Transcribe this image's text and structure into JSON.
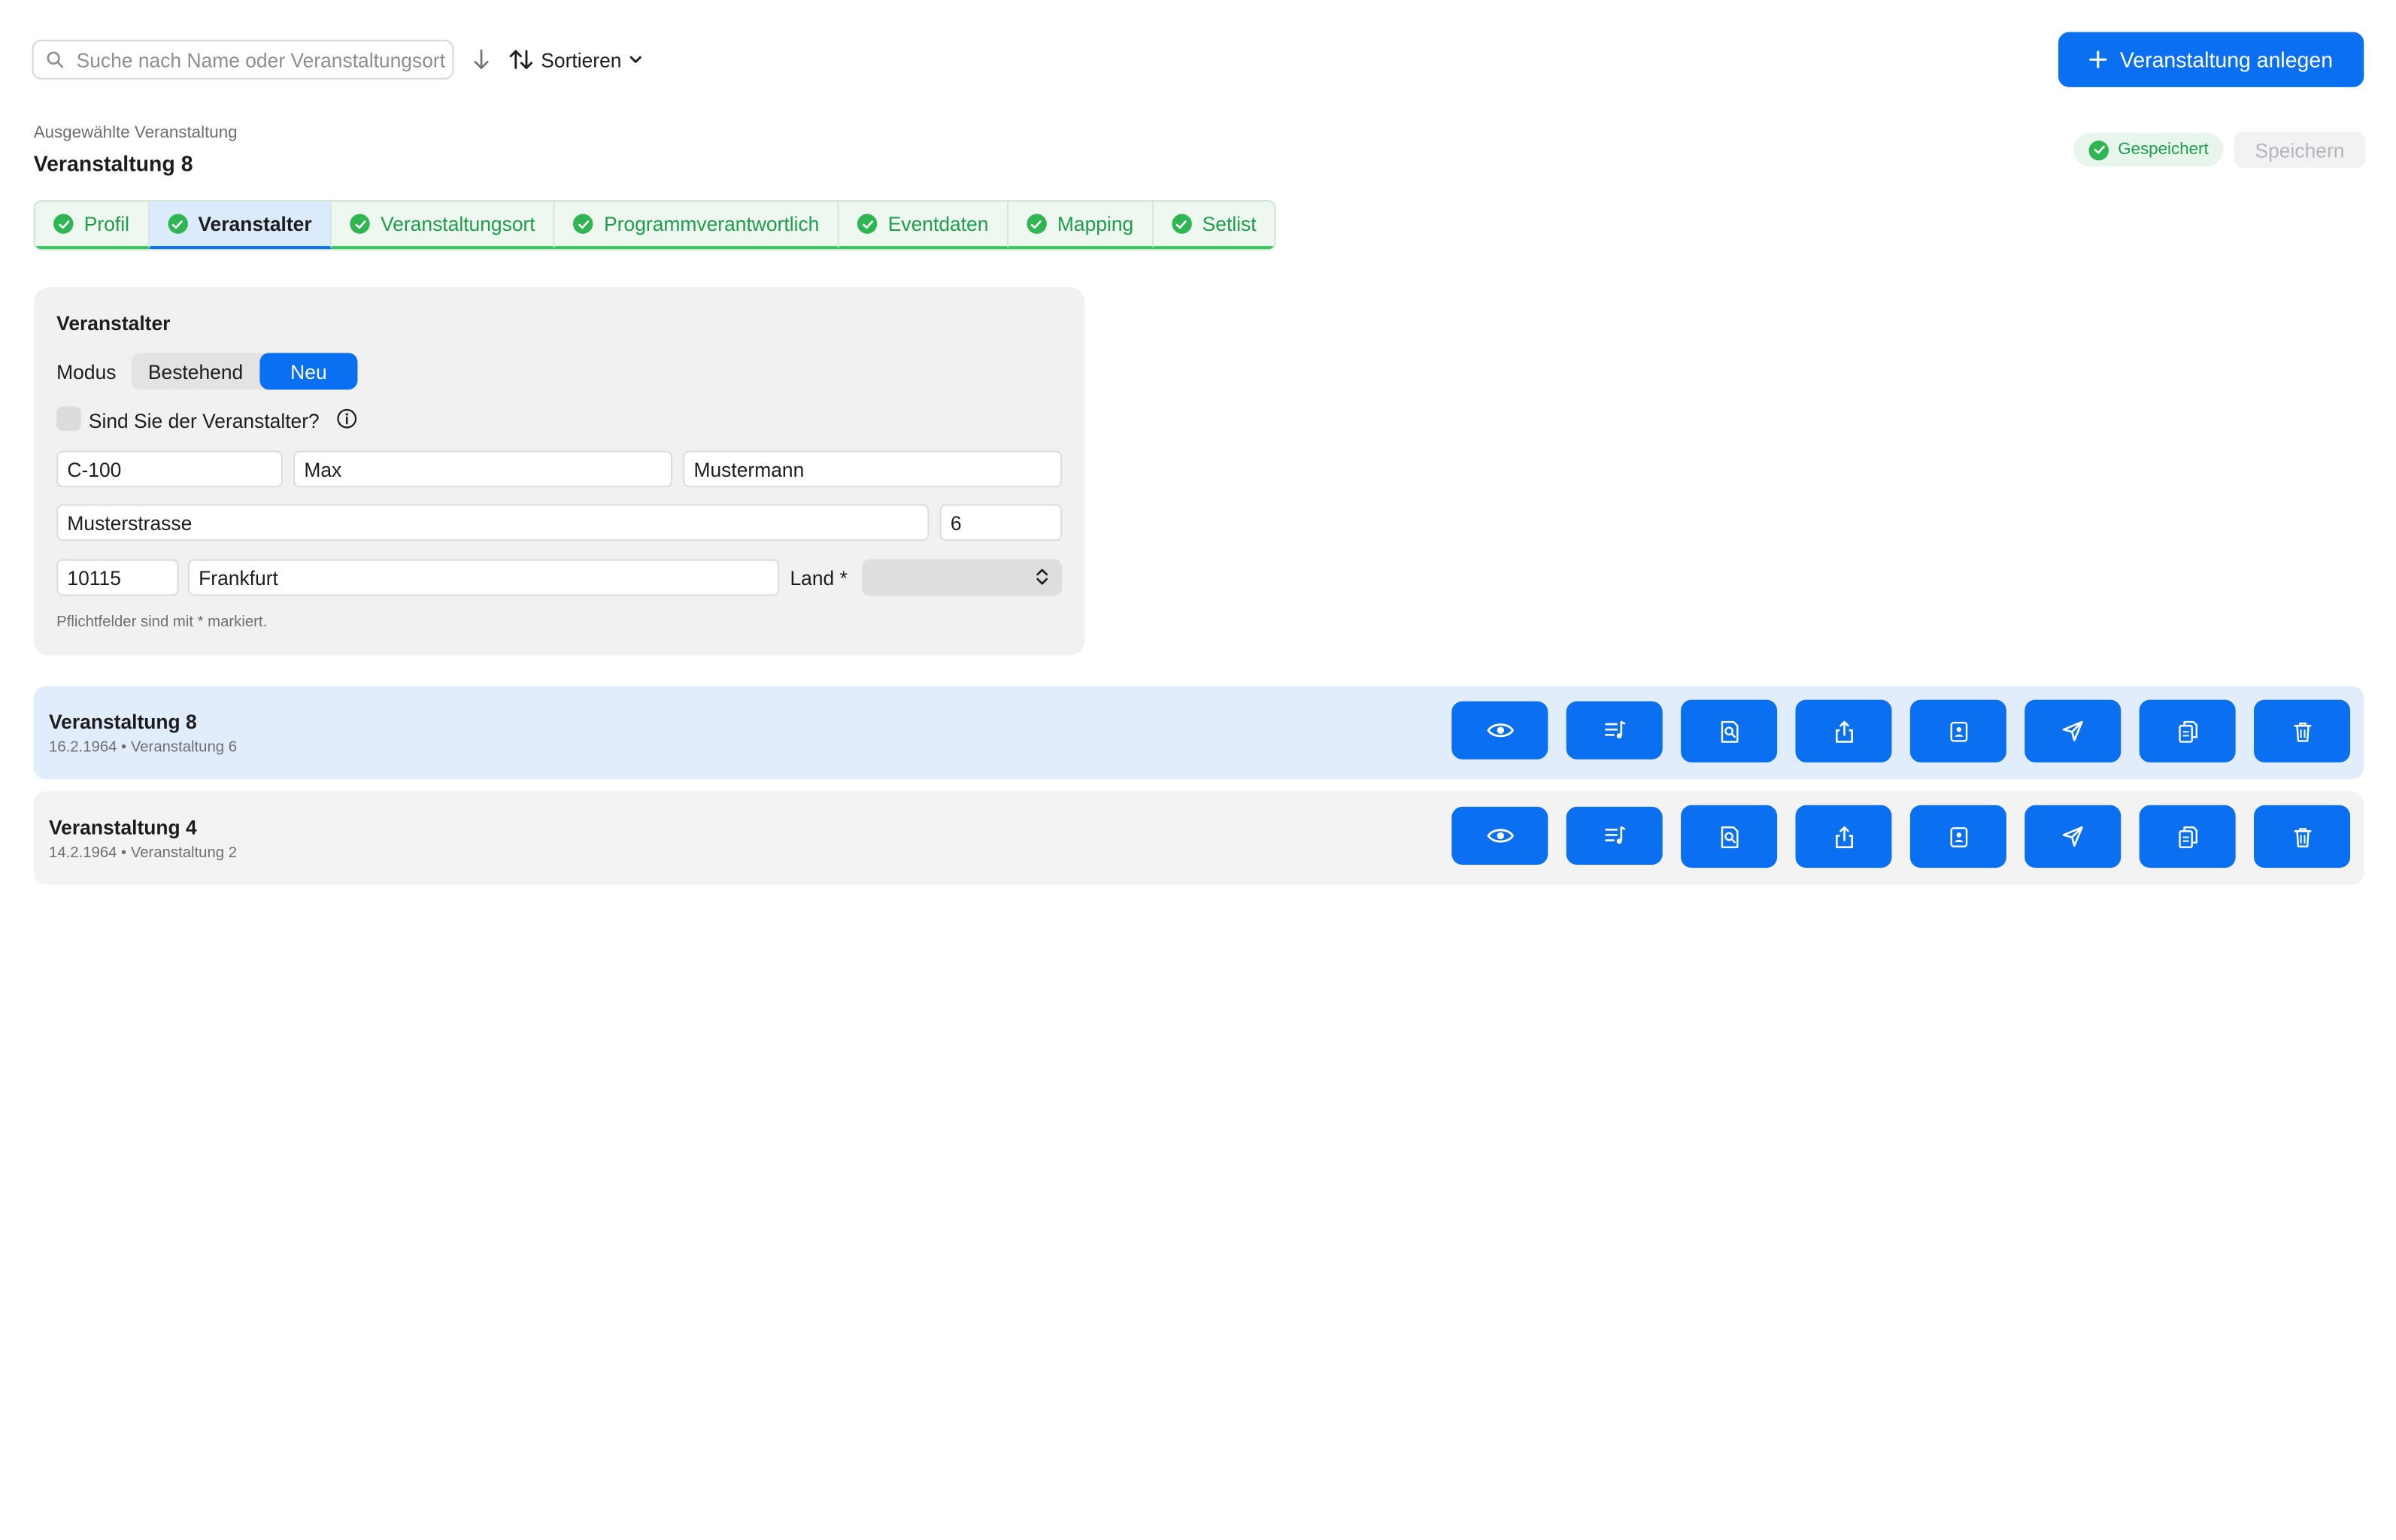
{
  "search": {
    "placeholder": "Suche nach Name oder Veranstaltungsort"
  },
  "toolbar": {
    "sort_label": "Sortieren",
    "create_label": "Veranstaltung anlegen"
  },
  "selection": {
    "caption": "Ausgewählte Veranstaltung",
    "title": "Veranstaltung 8",
    "saved_label": "Gespeichert",
    "save_button": "Speichern"
  },
  "tabs": [
    {
      "label": "Profil",
      "completed": true
    },
    {
      "label": "Veranstalter",
      "completed": true,
      "active": true
    },
    {
      "label": "Veranstaltungsort",
      "completed": true
    },
    {
      "label": "Programmverantwortlich",
      "completed": true
    },
    {
      "label": "Eventdaten",
      "completed": true
    },
    {
      "label": "Mapping",
      "completed": true
    },
    {
      "label": "Setlist",
      "completed": true
    }
  ],
  "form": {
    "title": "Veranstalter",
    "mode_label": "Modus",
    "mode_options": [
      "Bestehend",
      "Neu"
    ],
    "mode_selected": "Neu",
    "is_organizer_label": "Sind Sie der Veranstalter?",
    "is_organizer_checked": false,
    "customer_id": "C-100",
    "first_name": "Max",
    "last_name": "Mustermann",
    "street": "Musterstrasse",
    "house_number": "6",
    "zip": "10115",
    "city": "Frankfurt",
    "country_label": "Land *",
    "country_value": "",
    "hint": "Pflichtfelder sind mit * markiert."
  },
  "events": [
    {
      "title": "Veranstaltung 8",
      "subtitle": "16.2.1964 • Veranstaltung 6",
      "selected": true
    },
    {
      "title": "Veranstaltung 4",
      "subtitle": "14.2.1964 • Veranstaltung 2",
      "selected": false
    }
  ],
  "row_actions": [
    "eye-icon",
    "setlist-icon",
    "document-search-icon",
    "share-icon",
    "contact-card-icon",
    "send-icon",
    "copy-icon",
    "trash-icon"
  ],
  "colors": {
    "accent": "#0a6ff0",
    "success": "#2fb552",
    "selected_row": "#e2edfb"
  }
}
